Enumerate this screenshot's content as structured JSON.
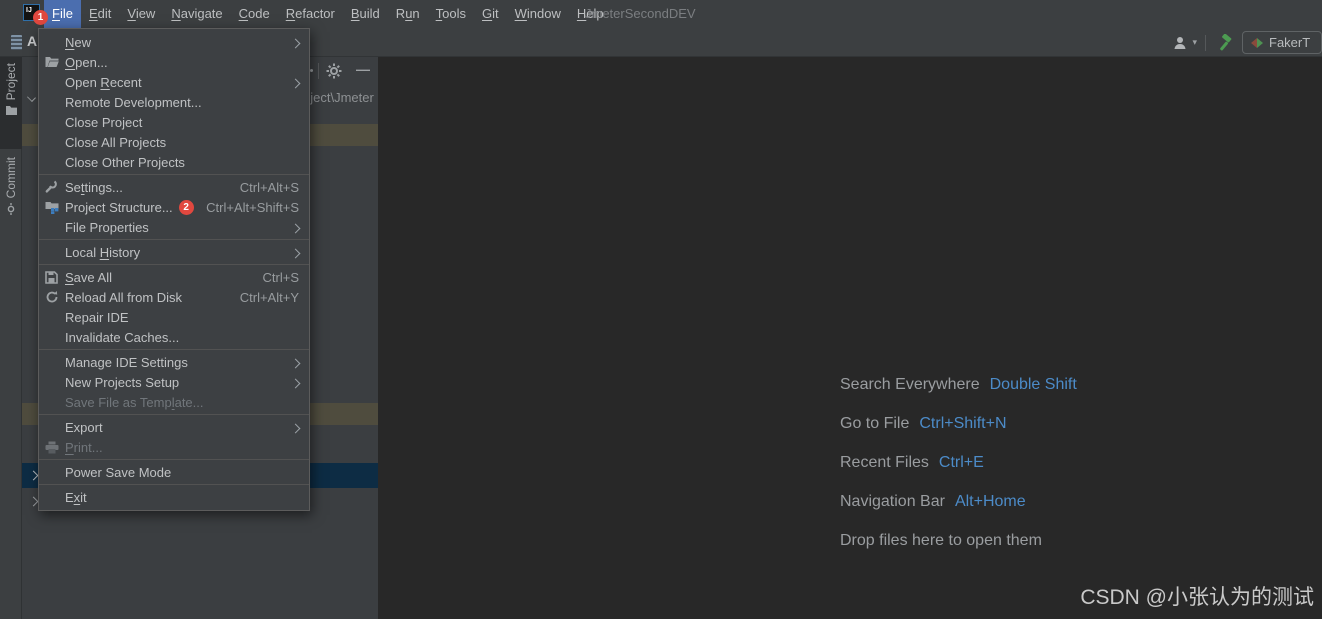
{
  "title_bar": {
    "logo_text": "IJ",
    "logo_badge": "1",
    "title": "JmeterSecondDEV",
    "menus": [
      {
        "label": "File",
        "m": 0
      },
      {
        "label": "Edit",
        "m": 0
      },
      {
        "label": "View",
        "m": 0
      },
      {
        "label": "Navigate",
        "m": 0
      },
      {
        "label": "Code",
        "m": 0
      },
      {
        "label": "Refactor",
        "m": 0
      },
      {
        "label": "Build",
        "m": 0
      },
      {
        "label": "Run",
        "m": 1
      },
      {
        "label": "Tools",
        "m": 0
      },
      {
        "label": "Git",
        "m": 0
      },
      {
        "label": "Window",
        "m": 0
      },
      {
        "label": "Help",
        "m": 0
      }
    ]
  },
  "toolbar": {
    "project_letter": "A",
    "run_widget_label": "FakerT",
    "minimize_glyph": "—"
  },
  "stripe_tabs": {
    "project": "Project",
    "commit": "Commit"
  },
  "project_panel": {
    "path_text": "oject\\Jmeter"
  },
  "file_menu": {
    "items": [
      {
        "label": "New",
        "m": 0,
        "submenu": true
      },
      {
        "label": "Open...",
        "m": 0,
        "icon": "folder-open-icon"
      },
      {
        "label": "Open Recent",
        "m": 5,
        "submenu": true
      },
      {
        "label": "Remote Development..."
      },
      {
        "label": "Close Project"
      },
      {
        "label": "Close All Projects"
      },
      {
        "label": "Close Other Projects"
      },
      {
        "label": "Settings...",
        "m": 2,
        "icon": "wrench-icon",
        "shortcut": "Ctrl+Alt+S"
      },
      {
        "label": "Project Structure...",
        "icon": "project-structure-icon",
        "badge": "2",
        "shortcut": "Ctrl+Alt+Shift+S"
      },
      {
        "label": "File Properties",
        "submenu": true
      },
      {
        "label": "Local History",
        "m": 6,
        "submenu": true
      },
      {
        "label": "Save All",
        "m": 0,
        "icon": "save-icon",
        "shortcut": "Ctrl+S"
      },
      {
        "label": "Reload All from Disk",
        "icon": "reload-icon",
        "shortcut": "Ctrl+Alt+Y"
      },
      {
        "label": "Repair IDE"
      },
      {
        "label": "Invalidate Caches..."
      },
      {
        "label": "Manage IDE Settings",
        "submenu": true
      },
      {
        "label": "New Projects Setup",
        "submenu": true
      },
      {
        "label": "Save File as Template...",
        "m": 17,
        "disabled": true
      },
      {
        "label": "Export",
        "submenu": true
      },
      {
        "label": "Print...",
        "m": 0,
        "icon": "printer-icon",
        "disabled": true
      },
      {
        "label": "Power Save Mode"
      },
      {
        "label": "Exit",
        "m": 1
      }
    ]
  },
  "editor": {
    "hints": [
      {
        "label": "Search Everywhere",
        "keys": "Double Shift"
      },
      {
        "label": "Go to File",
        "keys": "Ctrl+Shift+N"
      },
      {
        "label": "Recent Files",
        "keys": "Ctrl+E"
      },
      {
        "label": "Navigation Bar",
        "keys": "Alt+Home"
      }
    ],
    "drop_hint": "Drop files here to open them",
    "watermark": "CSDN @小张认为的测试"
  },
  "colors": {
    "panel_bg": "#3c3f41",
    "editor_bg": "#282828",
    "menu_selection_blue": "#4b6eaf",
    "hint_key_blue": "#4c8bc8",
    "badge_red": "#e1483f",
    "row_khaki": "#4f4c3e",
    "row_navy": "#0d2c44",
    "hammer_green": "#4c9b51"
  }
}
